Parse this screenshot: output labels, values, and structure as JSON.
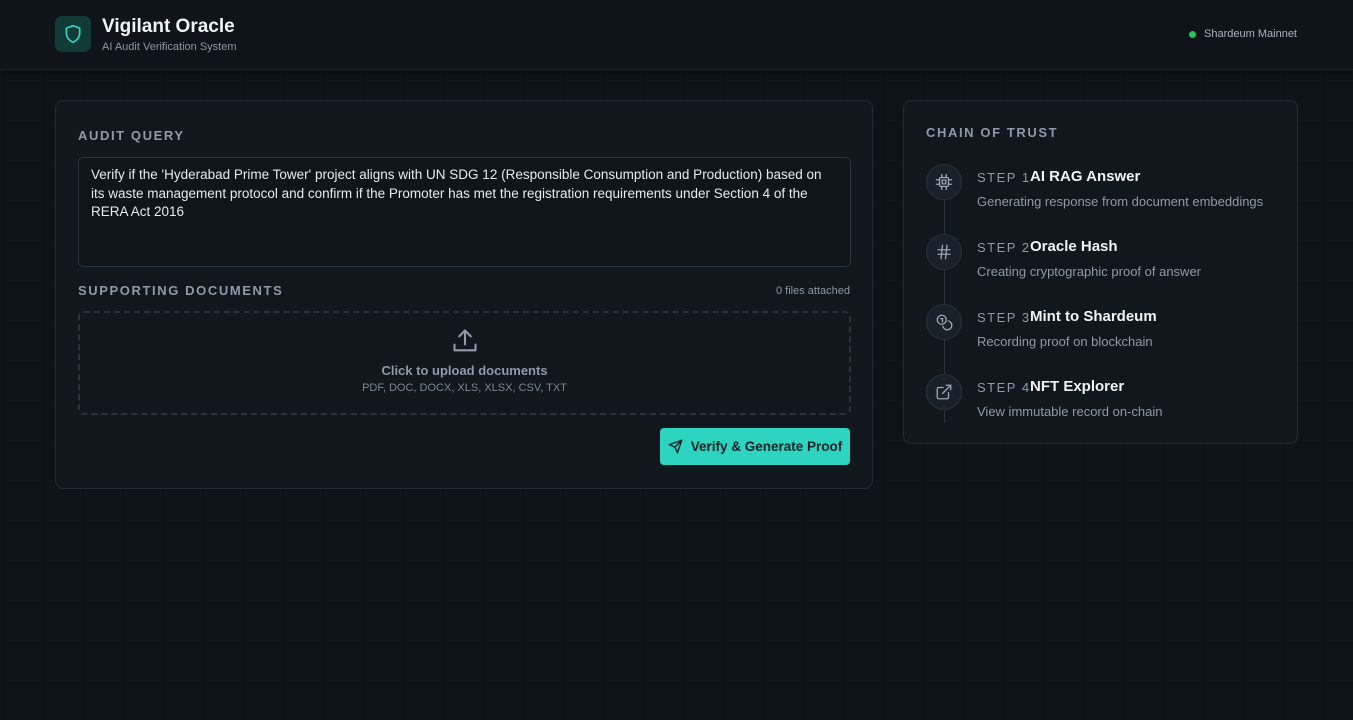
{
  "header": {
    "title": "Vigilant Oracle",
    "subtitle": "AI Audit Verification System",
    "network_label": "Shardeum Mainnet",
    "network_status_color": "#22c55e",
    "logo_icon": "shield-icon"
  },
  "audit": {
    "label": "AUDIT QUERY",
    "query": "Verify if the 'Hyderabad Prime Tower' project aligns with UN SDG 12 (Responsible Consumption and Production) based on its waste management protocol and confirm if the Promoter has met the registration requirements under Section 4 of the RERA Act 2016"
  },
  "documents": {
    "label": "SUPPORTING DOCUMENTS",
    "count_text": "0 files attached",
    "upload_title": "Click to upload documents",
    "upload_formats": "PDF, DOC, DOCX, XLS, XLSX, CSV, TXT",
    "upload_icon": "upload-icon"
  },
  "submit": {
    "label": "Verify & Generate Proof",
    "icon": "send-icon",
    "accent_color": "#2dd4bf"
  },
  "chain": {
    "label": "CHAIN OF TRUST",
    "steps": [
      {
        "number": "STEP 1",
        "title": "AI RAG Answer",
        "description": "Generating response from document embeddings",
        "icon": "cpu-icon"
      },
      {
        "number": "STEP 2",
        "title": "Oracle Hash",
        "description": "Creating cryptographic proof of answer",
        "icon": "hash-icon"
      },
      {
        "number": "STEP 3",
        "title": "Mint to Shardeum",
        "description": "Recording proof on blockchain",
        "icon": "coins-icon"
      },
      {
        "number": "STEP 4",
        "title": "NFT Explorer",
        "description": "View immutable record on-chain",
        "icon": "external-link-icon"
      }
    ]
  }
}
